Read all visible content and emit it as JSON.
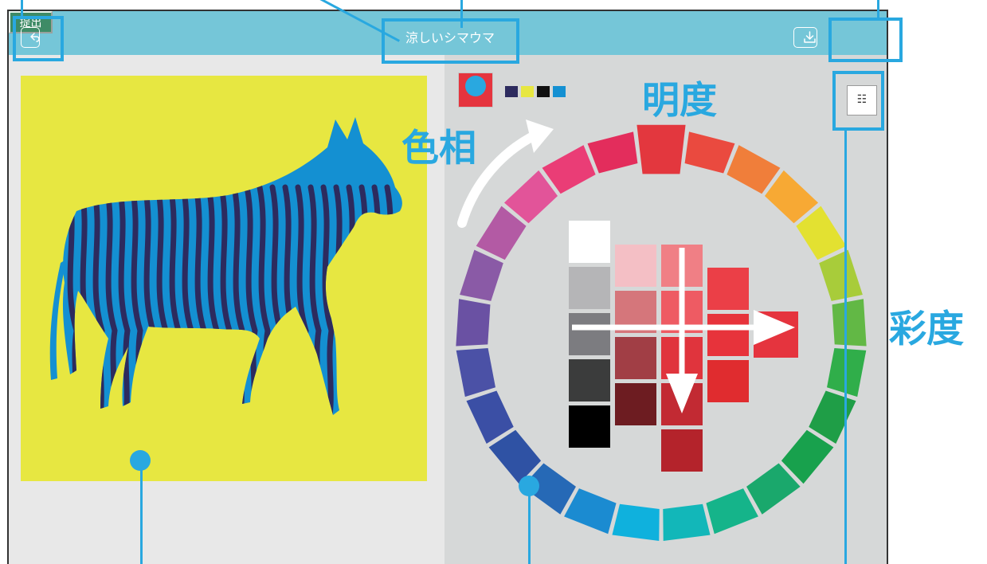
{
  "header": {
    "title": "涼しいシマウマ",
    "submit_label": "提出",
    "back_icon": "back-arrow-icon",
    "download_icon": "download-icon"
  },
  "canvas": {
    "background_color": "#e7e741",
    "subject": "zebra-illustration",
    "zebra_base_color": "#1490d2",
    "zebra_stripe_color": "#2d2b5e"
  },
  "color_picker": {
    "current_color": "#e5343e",
    "palette": [
      "#2d2b5e",
      "#e7e741",
      "#111111",
      "#1490d2"
    ],
    "menu_icon": "list-icon",
    "hue_wheel": [
      "#e3373e",
      "#ea4a3f",
      "#f07e3a",
      "#f7a934",
      "#e3e131",
      "#a8cc3a",
      "#62b845",
      "#30ae4a",
      "#1f9e47",
      "#18a14d",
      "#1aa86c",
      "#15b48a",
      "#12b7b9",
      "#0fb1dd",
      "#1b8bd1",
      "#2669b6",
      "#2f52a4",
      "#3b4fa5",
      "#4b51a6",
      "#6a51a3",
      "#8a5aa6",
      "#b35aa4",
      "#e25499",
      "#ea3d76",
      "#e32d5c"
    ],
    "gray_column": [
      "#ffffff",
      "#b5b5b7",
      "#7c7c80",
      "#3b3c3c",
      "#000000"
    ],
    "tint_column": [
      "#f4bfc5",
      "#d5767b",
      "#a13e45",
      "#6d1c21"
    ],
    "mid_column": [
      "#f07f85",
      "#ee5b63",
      "#e0343d",
      "#c22a33",
      "#b4232b"
    ],
    "sat_column": [
      "#eb3f47",
      "#e7333b",
      "#e02c2f"
    ],
    "pure_swatch": "#e5343e"
  },
  "annotations": {
    "hue": "色相",
    "brightness": "明度",
    "saturation": "彩度",
    "accent_color": "#29a8e0"
  }
}
